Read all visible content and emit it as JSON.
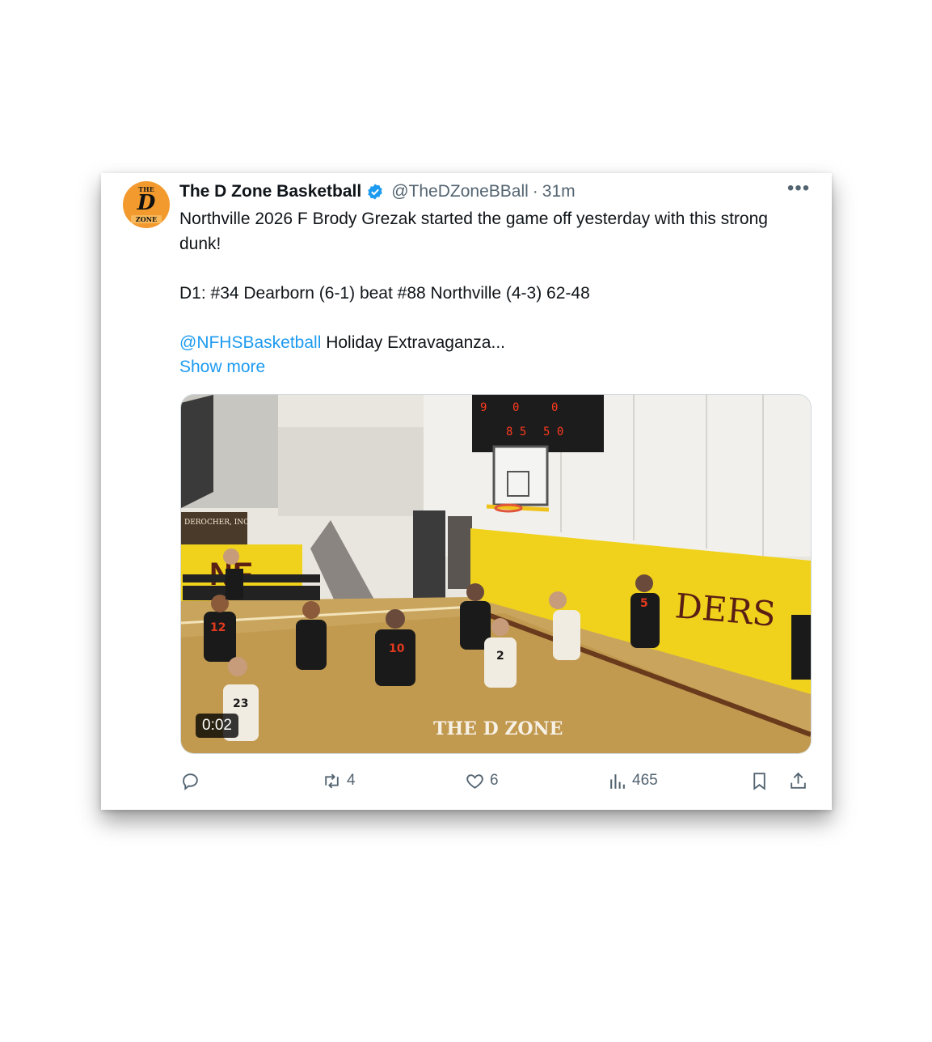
{
  "tweet": {
    "display_name": "The D Zone Basketball",
    "handle": "@TheDZoneBBall",
    "separator": "·",
    "time": "31m",
    "verified": true,
    "avatar_text": {
      "top": "THE",
      "letter": "D",
      "bottom": "ZONE"
    },
    "text_line1": "Northville 2026 F Brody Grezak started the game off yesterday with this strong dunk!",
    "text_line2": "D1:  #34 Dearborn (6-1) beat #88 Northville (4-3) 62-48",
    "mention": "@NFHSBasketball",
    "text_line3_rest": " Holiday Extravaganza...",
    "show_more": "Show more"
  },
  "video": {
    "duration": "0:02",
    "watermark": "THE D ZONE",
    "banner_text": "DEROCHER, INC.",
    "wall_text": "DERS",
    "jersey_numbers": [
      "12",
      "10",
      "2",
      "23",
      "5"
    ]
  },
  "actions": {
    "reply": {
      "icon": "reply-icon",
      "count": ""
    },
    "retweet": {
      "icon": "retweet-icon",
      "count": "4"
    },
    "like": {
      "icon": "heart-icon",
      "count": "6"
    },
    "views": {
      "icon": "views-chart-icon",
      "count": "465"
    },
    "bookmark": {
      "icon": "bookmark-icon"
    },
    "share": {
      "icon": "share-icon"
    }
  },
  "colors": {
    "accent": "#1d9bf0",
    "secondary_text": "#536471",
    "court_yellow": "#f0d21c"
  }
}
